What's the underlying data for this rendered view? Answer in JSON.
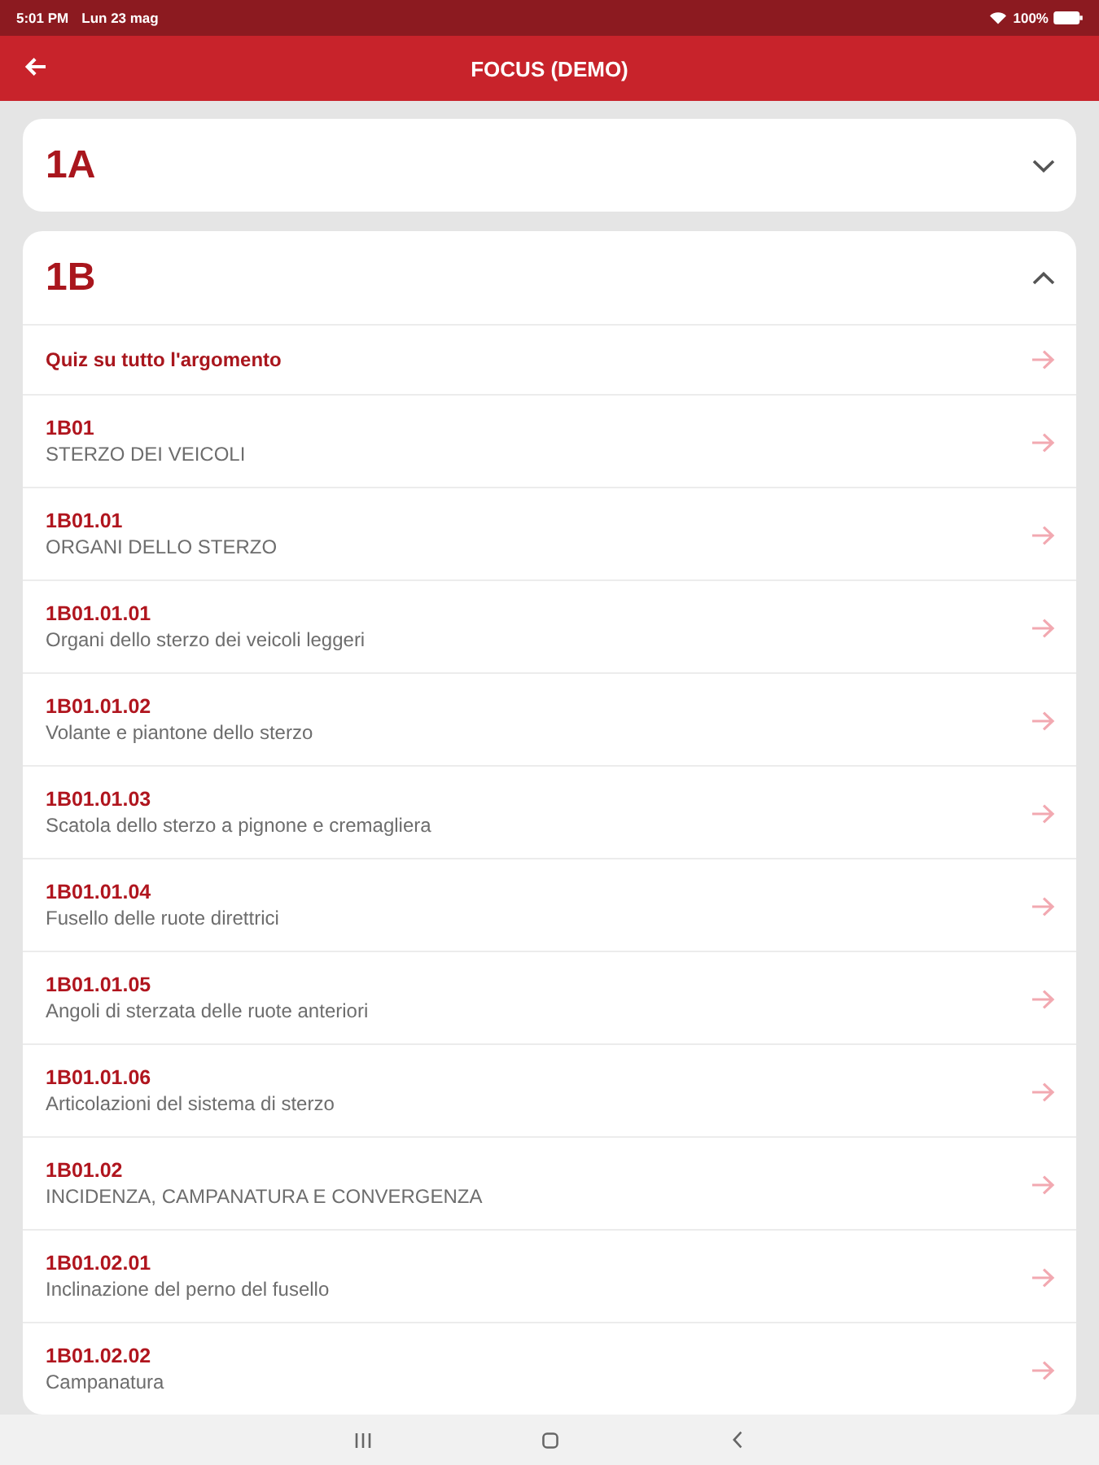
{
  "status_bar": {
    "time": "5:01 PM",
    "date": "Lun 23 mag",
    "battery": "100%"
  },
  "app_bar": {
    "title": "FOCUS (DEMO)"
  },
  "sections": [
    {
      "title": "1A",
      "expanded": false
    },
    {
      "title": "1B",
      "expanded": true,
      "items": [
        {
          "kind": "quiz",
          "label": "Quiz su tutto l'argomento"
        },
        {
          "kind": "topic",
          "code": "1B01",
          "title": "STERZO DEI VEICOLI"
        },
        {
          "kind": "topic",
          "code": "1B01.01",
          "title": "ORGANI DELLO STERZO"
        },
        {
          "kind": "topic",
          "code": "1B01.01.01",
          "title": "Organi dello sterzo dei veicoli leggeri"
        },
        {
          "kind": "topic",
          "code": "1B01.01.02",
          "title": "Volante e piantone dello sterzo"
        },
        {
          "kind": "topic",
          "code": "1B01.01.03",
          "title": "Scatola dello sterzo a pignone e cremagliera"
        },
        {
          "kind": "topic",
          "code": "1B01.01.04",
          "title": "Fusello delle ruote direttrici"
        },
        {
          "kind": "topic",
          "code": "1B01.01.05",
          "title": "Angoli di sterzata delle ruote anteriori"
        },
        {
          "kind": "topic",
          "code": "1B01.01.06",
          "title": "Articolazioni del sistema di sterzo"
        },
        {
          "kind": "topic",
          "code": "1B01.02",
          "title": "INCIDENZA, CAMPANATURA E CONVERGENZA"
        },
        {
          "kind": "topic",
          "code": "1B01.02.01",
          "title": "Inclinazione del perno del fusello"
        },
        {
          "kind": "topic",
          "code": "1B01.02.02",
          "title": "Campanatura"
        }
      ]
    }
  ]
}
